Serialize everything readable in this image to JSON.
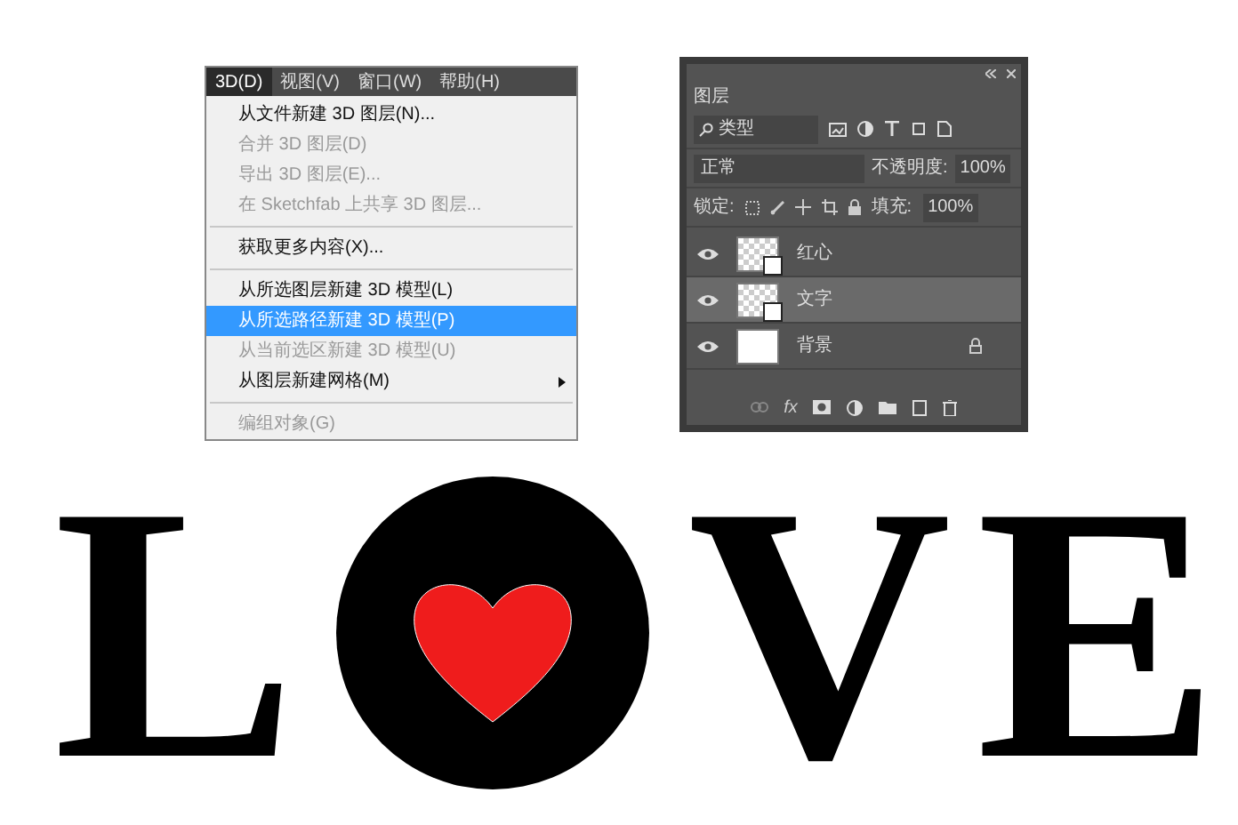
{
  "menu_bar": [
    {
      "label": "3D(D)",
      "selected": true
    },
    {
      "label": "视图(V)",
      "selected": false
    },
    {
      "label": "窗口(W)",
      "selected": false
    },
    {
      "label": "帮助(H)",
      "selected": false
    }
  ],
  "menu_items": [
    {
      "kind": "item",
      "label": "从文件新建 3D 图层(N)...",
      "disabled": false,
      "selected": false,
      "submenu": false
    },
    {
      "kind": "item",
      "label": "合并 3D 图层(D)",
      "disabled": true,
      "selected": false,
      "submenu": false
    },
    {
      "kind": "item",
      "label": "导出 3D 图层(E)...",
      "disabled": true,
      "selected": false,
      "submenu": false
    },
    {
      "kind": "item",
      "label": "在 Sketchfab 上共享 3D 图层...",
      "disabled": true,
      "selected": false,
      "submenu": false
    },
    {
      "kind": "separator"
    },
    {
      "kind": "item",
      "label": "获取更多内容(X)...",
      "disabled": false,
      "selected": false,
      "submenu": false
    },
    {
      "kind": "separator"
    },
    {
      "kind": "item",
      "label": "从所选图层新建 3D 模型(L)",
      "disabled": false,
      "selected": false,
      "submenu": false
    },
    {
      "kind": "item",
      "label": "从所选路径新建 3D 模型(P)",
      "disabled": false,
      "selected": true,
      "submenu": false
    },
    {
      "kind": "item",
      "label": "从当前选区新建 3D 模型(U)",
      "disabled": true,
      "selected": false,
      "submenu": false
    },
    {
      "kind": "item",
      "label": "从图层新建网格(M)",
      "disabled": false,
      "selected": false,
      "submenu": true
    },
    {
      "kind": "separator"
    },
    {
      "kind": "item",
      "label": "编组对象(G)",
      "disabled": true,
      "selected": false,
      "submenu": false
    }
  ],
  "layers_panel": {
    "title": "图层",
    "filter": "类型",
    "blend_mode": "正常",
    "opacity_label": "不透明度:",
    "opacity": "100%",
    "lock_label": "锁定:",
    "fill_label": "填充:",
    "fill": "100%",
    "fx": "fx",
    "layers": [
      {
        "name": "红心",
        "kind": "shape",
        "visible": true,
        "selected": false,
        "locked": false
      },
      {
        "name": "文字",
        "kind": "shape",
        "visible": true,
        "selected": true,
        "locked": false
      },
      {
        "name": "背景",
        "kind": "background",
        "visible": true,
        "selected": false,
        "locked": true
      }
    ]
  },
  "artwork": [
    {
      "kind": "letter",
      "text": "L"
    },
    {
      "kind": "heart-circle"
    },
    {
      "kind": "letter",
      "text": "V"
    },
    {
      "kind": "letter",
      "text": "E"
    }
  ]
}
